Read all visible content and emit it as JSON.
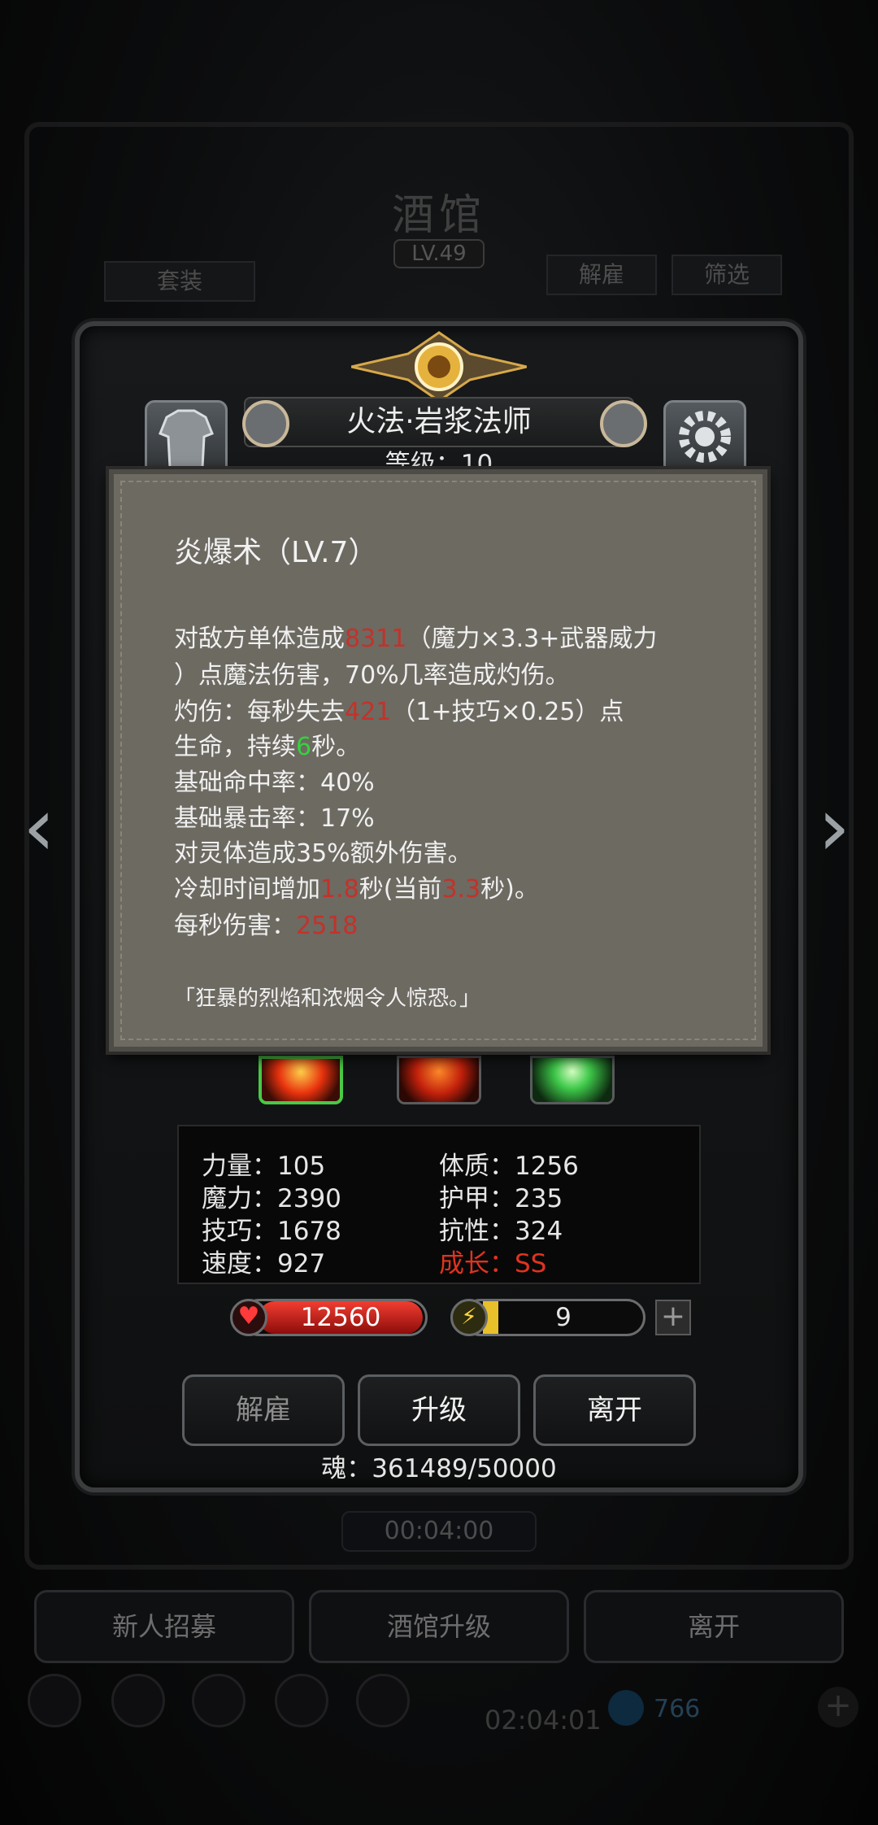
{
  "background": {
    "title": "酒馆",
    "level": "LV.49",
    "btn_set": "套装",
    "btn_fire": "解雇",
    "btn_filter": "筛选",
    "timer": "00:04:00",
    "bottom_buttons": [
      "新人招募",
      "酒馆升级",
      "离开"
    ],
    "footer_timer": "02:04:01",
    "footer_count": "766"
  },
  "hero": {
    "name": "火法·岩浆法师",
    "level_label": "等级：10",
    "left_side_label": "皮肤",
    "right_side_label": "战术"
  },
  "tooltip": {
    "title": "炎爆术（LV.7）",
    "line1_a": "对敌方单体造成",
    "line1_dmg": "8311",
    "line1_b": "（魔力×3.3+武器威力",
    "line2": "）点魔法伤害，70%几率造成灼伤。",
    "line3_a": "灼伤：每秒失去",
    "line3_val": "421",
    "line3_b": "（1+技巧×0.25）点",
    "line4_a": "生命，持续",
    "line4_val": "6",
    "line4_b": "秒。",
    "line5": "基础命中率：40%",
    "line6": "基础暴击率：17%",
    "line7": "对灵体造成35%额外伤害。",
    "line8_a": "冷却时间增加",
    "line8_v1": "1.8",
    "line8_b": "秒(当前",
    "line8_v2": "3.3",
    "line8_c": "秒)。",
    "line9_a": "每秒伤害：",
    "line9_val": "2518",
    "flavor": "「狂暴的烈焰和浓烟令人惊恐。」"
  },
  "stats": {
    "str": "力量：105",
    "con": "体质：1256",
    "mag": "魔力：2390",
    "arm": "护甲：235",
    "skl": "技巧：1678",
    "res": "抗性：324",
    "spd": "速度：927",
    "growth": "成长：SS"
  },
  "hp": "12560",
  "energy": "9",
  "energy_fraction": 0.1,
  "actions": {
    "fire": "解雇",
    "upgrade": "升级",
    "leave": "离开"
  },
  "soul": "魂：361489/50000",
  "colors": {
    "damage_red": "#c3322a",
    "duration_green": "#35d23c",
    "growth_red": "#e0331f",
    "hp_red": "#f23d31",
    "energy_yellow": "#e8c02a"
  }
}
